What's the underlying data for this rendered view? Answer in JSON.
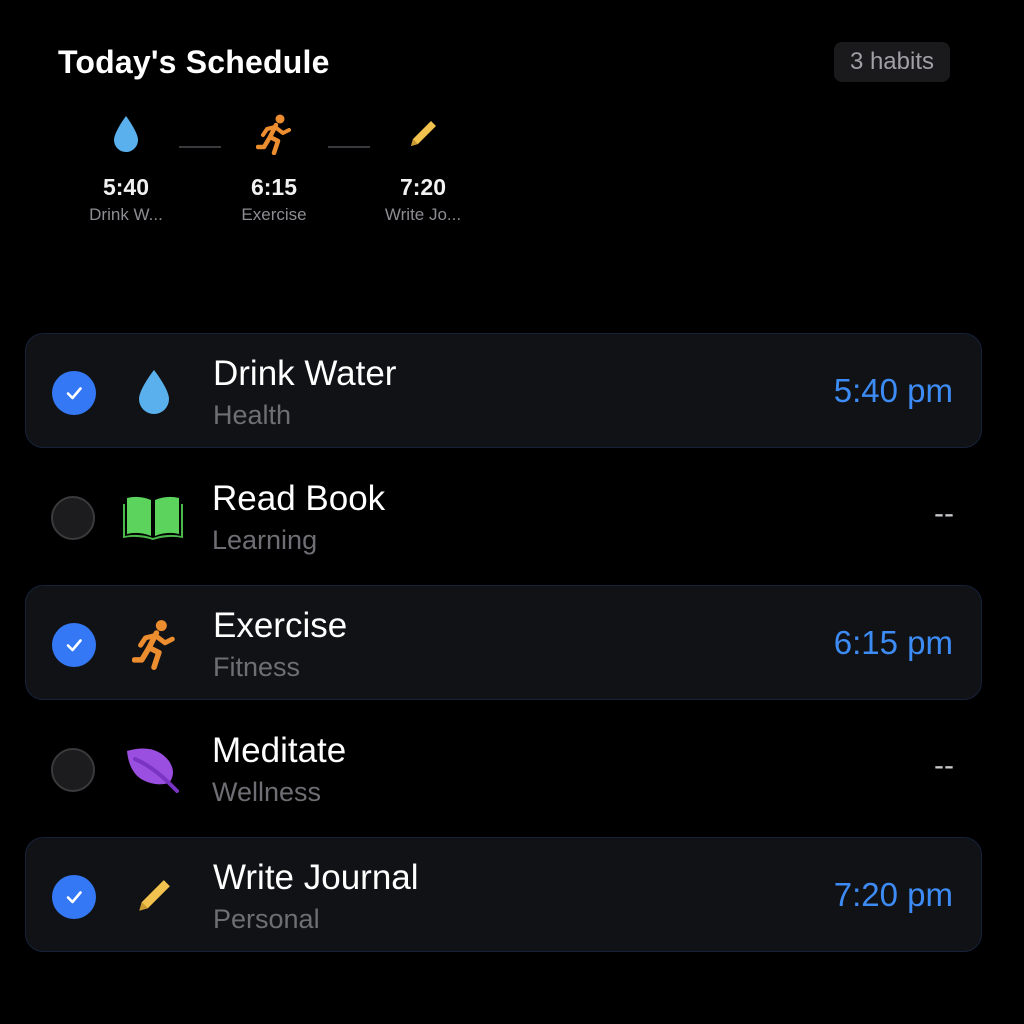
{
  "header": {
    "title": "Today's Schedule",
    "count_badge": "3 habits"
  },
  "timeline": [
    {
      "icon": "water-drop-icon",
      "time": "5:40",
      "label": "Drink W..."
    },
    {
      "icon": "running-icon",
      "time": "6:15",
      "label": "Exercise"
    },
    {
      "icon": "pencil-icon",
      "time": "7:20",
      "label": "Write Jo..."
    }
  ],
  "habits": [
    {
      "title": "Drink Water",
      "category": "Health",
      "time": "5:40 pm",
      "completed": true,
      "icon": "water-drop-icon",
      "color": "#5ab0ec"
    },
    {
      "title": "Read Book",
      "category": "Learning",
      "time": "--",
      "completed": false,
      "icon": "book-icon",
      "color": "#5bd35c"
    },
    {
      "title": "Exercise",
      "category": "Fitness",
      "time": "6:15 pm",
      "completed": true,
      "icon": "running-icon",
      "color": "#ec8d2f"
    },
    {
      "title": "Meditate",
      "category": "Wellness",
      "time": "--",
      "completed": false,
      "icon": "leaf-icon",
      "color": "#9b4fe0"
    },
    {
      "title": "Write Journal",
      "category": "Personal",
      "time": "7:20 pm",
      "completed": true,
      "icon": "pencil-icon",
      "color": "#f2c24f"
    }
  ],
  "colors": {
    "accent": "#3478f6",
    "time_text": "#3d8cf6",
    "background": "#000000",
    "card": "#111215"
  }
}
